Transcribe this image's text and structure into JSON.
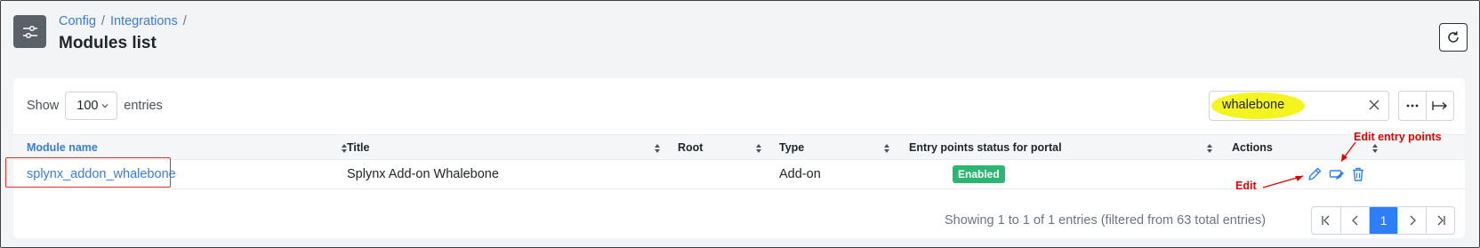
{
  "header": {
    "breadcrumb": [
      "Config",
      "Integrations"
    ],
    "title": "Modules list",
    "page_icon": "sliders-icon",
    "refresh_icon": "refresh-icon"
  },
  "controls": {
    "show_label": "Show",
    "entries_value": "100",
    "entries_label": "entries",
    "search_value": "whalebone",
    "more_icon": "more-icon",
    "export_icon": "arrow-right-to-bar-icon"
  },
  "table": {
    "columns": [
      "Module name",
      "Title",
      "Root",
      "Type",
      "Entry points status for portal",
      "Actions"
    ],
    "rows": [
      {
        "module_name": "splynx_addon_whalebone",
        "title": "Splynx Add-on Whalebone",
        "root": "",
        "type": "Add-on",
        "status": "Enabled"
      }
    ]
  },
  "annotations": {
    "edit": "Edit",
    "edit_entry_points": "Edit entry points"
  },
  "footer": {
    "info": "Showing 1 to 1 of 1 entries (filtered from 63 total entries)",
    "current_page": "1"
  },
  "colors": {
    "accent": "#2d7ef7",
    "link": "#3a7bd5",
    "badge_enabled": "#2bb673",
    "annotation": "#e00000",
    "highlight": "#f4f520"
  }
}
